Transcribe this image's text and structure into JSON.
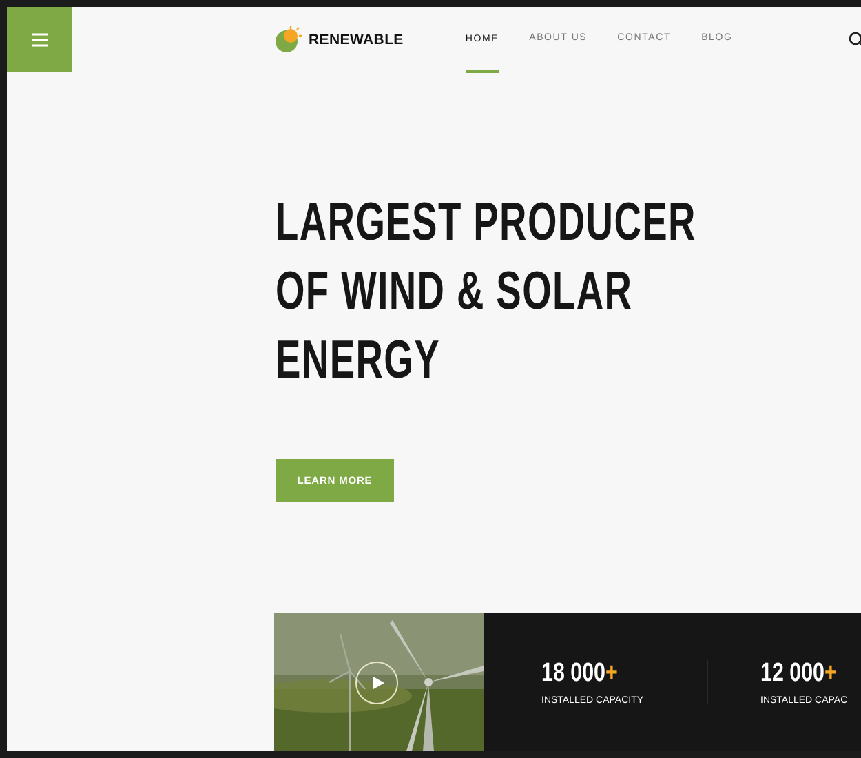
{
  "brand": {
    "name": "RENEWABLE"
  },
  "nav": [
    {
      "label": "HOME",
      "selected": true
    },
    {
      "label": "ABOUT US",
      "selected": false
    },
    {
      "label": "CONTACT",
      "selected": false
    },
    {
      "label": "BLOG",
      "selected": false
    }
  ],
  "hero": {
    "headline": [
      "LARGEST PRODUCER",
      "OF WIND & SOLAR",
      "ENERGY"
    ],
    "button": "LEARN MORE"
  },
  "stats": [
    {
      "value": "18 000",
      "suffix": "+",
      "label": "INSTALLED CAPACITY"
    },
    {
      "value": "12 000",
      "suffix": "+",
      "label": "INSTALLED CAPAC"
    }
  ]
}
